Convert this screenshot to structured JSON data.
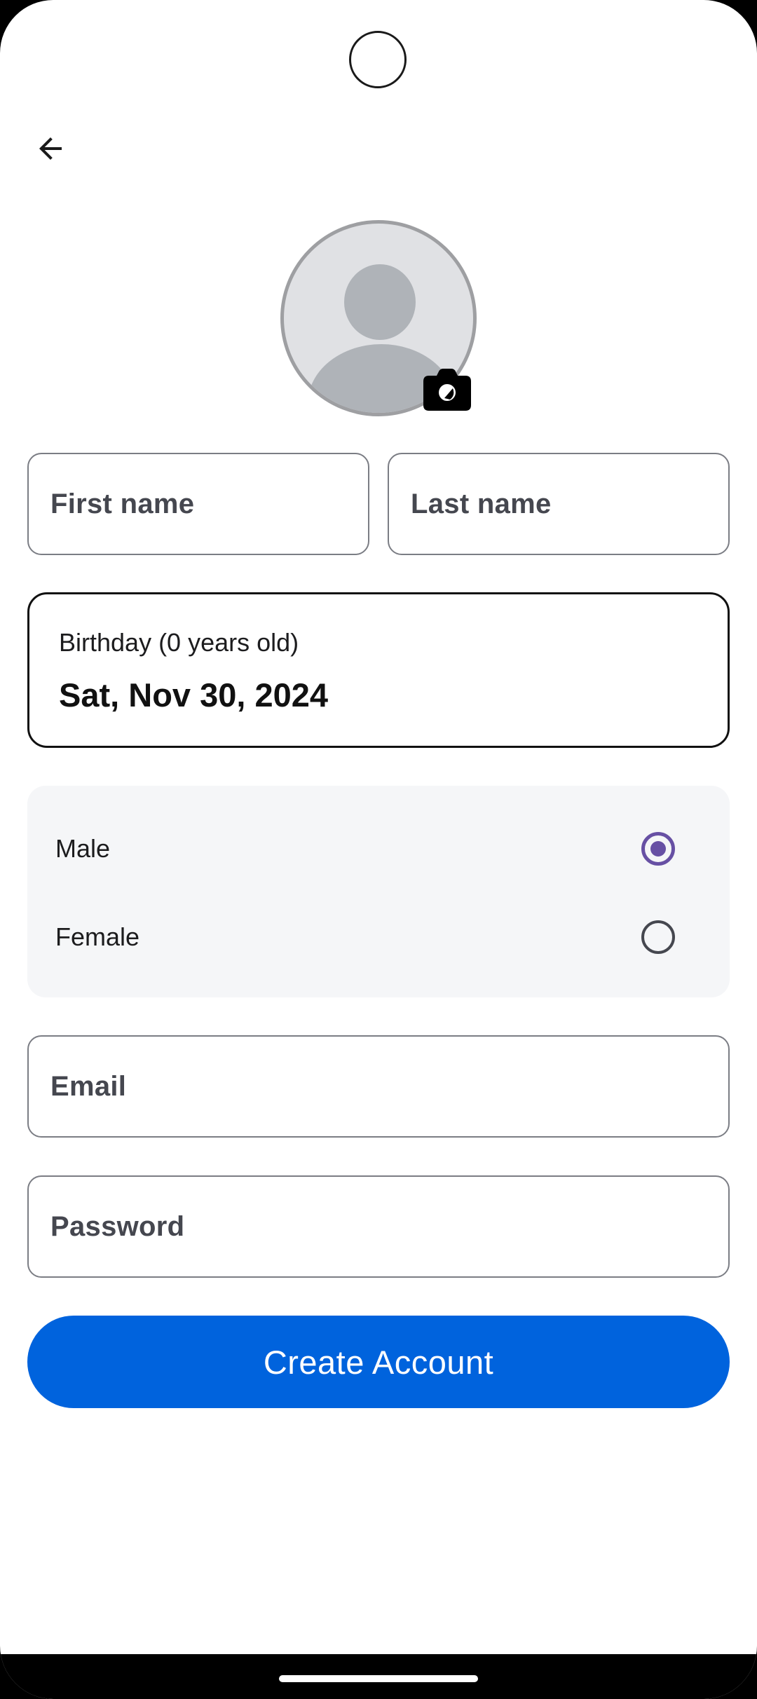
{
  "form": {
    "first_name_placeholder": "First name",
    "last_name_placeholder": "Last name",
    "email_placeholder": "Email",
    "password_placeholder": "Password"
  },
  "birthday": {
    "label": "Birthday (0 years old)",
    "value": "Sat, Nov 30, 2024"
  },
  "gender": {
    "options": [
      {
        "label": "Male",
        "selected": true
      },
      {
        "label": "Female",
        "selected": false
      }
    ]
  },
  "actions": {
    "create_account_label": "Create Account"
  },
  "icons": {
    "back": "arrow-back-icon",
    "avatar": "default-avatar-icon",
    "camera": "camera-icon"
  },
  "colors": {
    "primary_button": "#0063dd",
    "radio_selected": "#6750a4",
    "field_border": "#7b7d84",
    "avatar_bg": "#e0e1e4",
    "gender_card_bg": "#f5f6f8"
  }
}
